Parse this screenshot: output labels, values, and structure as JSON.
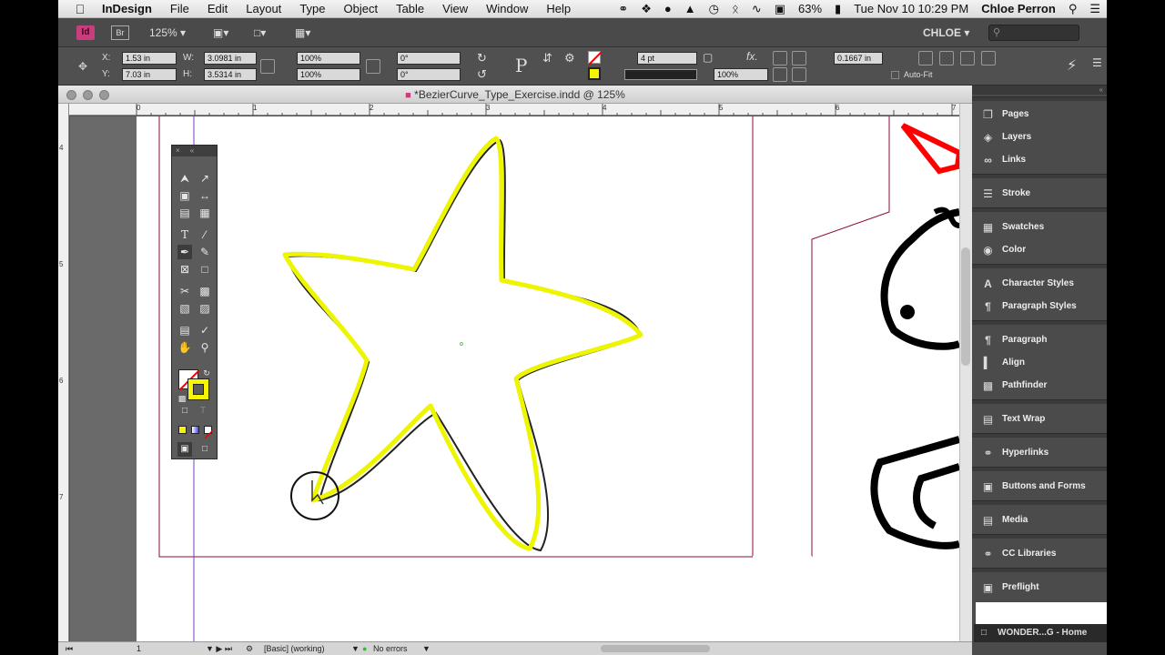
{
  "menubar": {
    "app": "InDesign",
    "items": [
      "File",
      "Edit",
      "Layout",
      "Type",
      "Object",
      "Table",
      "View",
      "Window",
      "Help"
    ],
    "battery": "63%",
    "datetime": "Tue Nov 10  10:29 PM",
    "user": "Chloe Perron"
  },
  "appbar": {
    "bridge": "Br",
    "zoom": "125%",
    "workspace": "CHLOE"
  },
  "control": {
    "x_label": "X:",
    "x": "1.53 in",
    "y_label": "Y:",
    "y": "7.03 in",
    "w_label": "W:",
    "w": "3.0981 in",
    "h_label": "H:",
    "h": "3.5314 in",
    "scale_x": "100%",
    "scale_y": "100%",
    "rotate": "0°",
    "shear": "0°",
    "stroke_weight": "4 pt",
    "opacity": "100%",
    "offset": "0.1667 in",
    "autofit": "Auto-Fit"
  },
  "document": {
    "title": "*BezierCurve_Type_Exercise.indd @ 125%",
    "ruler_h": [
      "0",
      "1",
      "2",
      "3",
      "4",
      "5",
      "6",
      "7"
    ],
    "ruler_v": [
      "4",
      "5",
      "6",
      "7"
    ]
  },
  "statusbar": {
    "page": "1",
    "style": "[Basic] (working)",
    "errors": "No errors"
  },
  "panels": [
    {
      "label": "Pages",
      "icon": "pages-icon"
    },
    {
      "label": "Layers",
      "icon": "layers-icon"
    },
    {
      "label": "Links",
      "icon": "links-icon"
    },
    {
      "label": "Stroke",
      "icon": "stroke-icon"
    },
    {
      "label": "Swatches",
      "icon": "swatches-icon"
    },
    {
      "label": "Color",
      "icon": "color-icon"
    },
    {
      "label": "Character Styles",
      "icon": "character-styles-icon"
    },
    {
      "label": "Paragraph Styles",
      "icon": "paragraph-styles-icon"
    },
    {
      "label": "Paragraph",
      "icon": "paragraph-icon"
    },
    {
      "label": "Align",
      "icon": "align-icon"
    },
    {
      "label": "Pathfinder",
      "icon": "pathfinder-icon"
    },
    {
      "label": "Text Wrap",
      "icon": "text-wrap-icon"
    },
    {
      "label": "Hyperlinks",
      "icon": "hyperlinks-icon"
    },
    {
      "label": "Buttons and Forms",
      "icon": "buttons-forms-icon"
    },
    {
      "label": "Media",
      "icon": "media-icon"
    },
    {
      "label": "CC Libraries",
      "icon": "cc-libraries-icon"
    },
    {
      "label": "Preflight",
      "icon": "preflight-icon"
    }
  ],
  "taskbar": {
    "label": "WONDER...G - Home"
  },
  "colors": {
    "star_highlight": "#eef500",
    "fill_swatch": "#f5f500",
    "unicorn_horn": "#ff0000",
    "page_margin": "#8c0a3c"
  }
}
